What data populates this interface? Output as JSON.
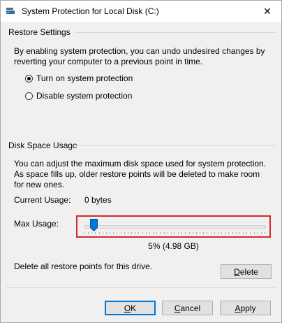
{
  "window": {
    "title": "System Protection for Local Disk (C:)",
    "close_glyph": "✕"
  },
  "restore_settings": {
    "header": "Restore Settings",
    "description": "By enabling system protection, you can undo undesired changes by reverting your computer to a previous point in time.",
    "options": [
      {
        "label": "Turn on system protection",
        "checked": true
      },
      {
        "label": "Disable system protection",
        "checked": false
      }
    ]
  },
  "disk_space": {
    "header": "Disk Space Usage",
    "description": "You can adjust the maximum disk space used for system protection. As space fills up, older restore points will be deleted to make room for new ones.",
    "current_usage_label": "Current Usage:",
    "current_usage_value": "0 bytes",
    "max_usage_label": "Max Usage:",
    "max_usage_percent": 5,
    "max_usage_readout": "5% (4.98 GB)",
    "highlight_color": "#d4282e"
  },
  "delete_section": {
    "text": "Delete all restore points for this drive.",
    "delete_button": {
      "mnemonic": "D",
      "rest": "elete"
    }
  },
  "footer": {
    "ok": {
      "mnemonic": "O",
      "rest": "K"
    },
    "cancel": {
      "mnemonic": "C",
      "rest": "ancel"
    },
    "apply": {
      "mnemonic": "A",
      "rest": "pply"
    }
  },
  "accent_color": "#0078d7"
}
